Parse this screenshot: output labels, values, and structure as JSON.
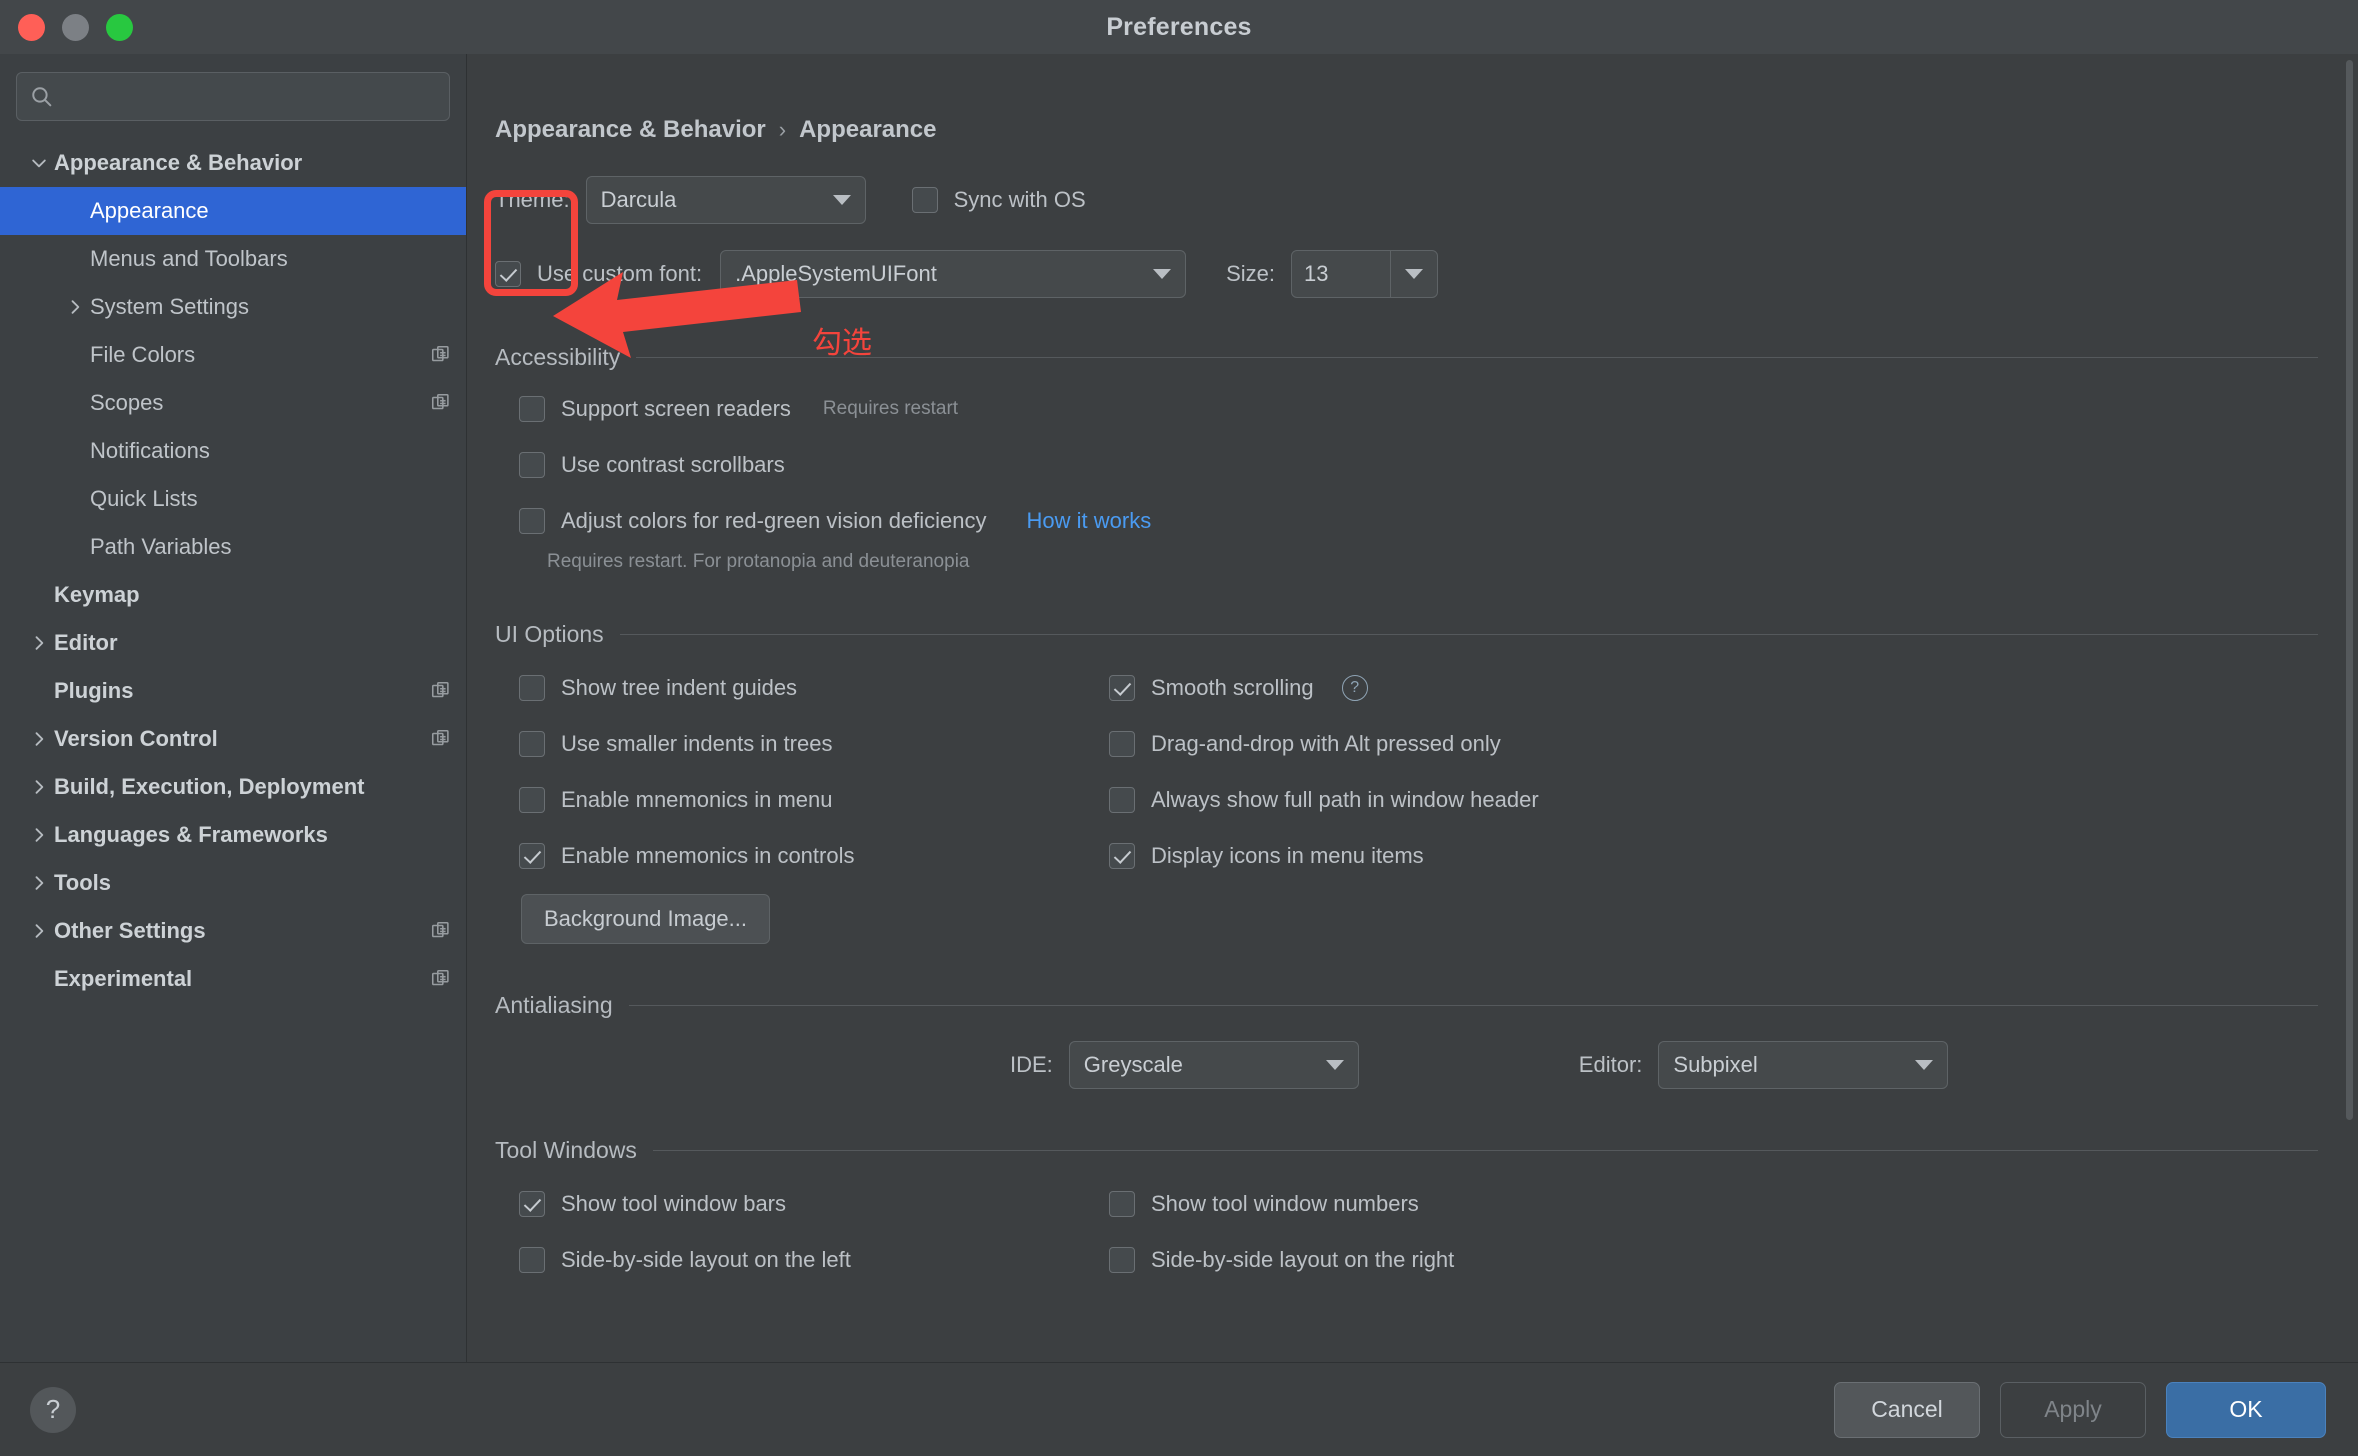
{
  "window": {
    "title": "Preferences",
    "traffic_lights": [
      "close",
      "minimize",
      "zoom"
    ]
  },
  "sidebar": {
    "search_placeholder": "",
    "search_value": "",
    "items": [
      {
        "label": "Appearance & Behavior",
        "indent": 0,
        "arrow": "down",
        "bold": true,
        "selected": false,
        "copy": false
      },
      {
        "label": "Appearance",
        "indent": 1,
        "arrow": "none",
        "bold": false,
        "selected": true,
        "copy": false
      },
      {
        "label": "Menus and Toolbars",
        "indent": 1,
        "arrow": "none",
        "bold": false,
        "selected": false,
        "copy": false
      },
      {
        "label": "System Settings",
        "indent": 1,
        "arrow": "right",
        "bold": false,
        "selected": false,
        "copy": false
      },
      {
        "label": "File Colors",
        "indent": 1,
        "arrow": "none",
        "bold": false,
        "selected": false,
        "copy": true
      },
      {
        "label": "Scopes",
        "indent": 1,
        "arrow": "none",
        "bold": false,
        "selected": false,
        "copy": true
      },
      {
        "label": "Notifications",
        "indent": 1,
        "arrow": "none",
        "bold": false,
        "selected": false,
        "copy": false
      },
      {
        "label": "Quick Lists",
        "indent": 1,
        "arrow": "none",
        "bold": false,
        "selected": false,
        "copy": false
      },
      {
        "label": "Path Variables",
        "indent": 1,
        "arrow": "none",
        "bold": false,
        "selected": false,
        "copy": false
      },
      {
        "label": "Keymap",
        "indent": 0,
        "arrow": "none",
        "bold": true,
        "selected": false,
        "copy": false
      },
      {
        "label": "Editor",
        "indent": 0,
        "arrow": "right",
        "bold": true,
        "selected": false,
        "copy": false
      },
      {
        "label": "Plugins",
        "indent": 0,
        "arrow": "none",
        "bold": true,
        "selected": false,
        "copy": true
      },
      {
        "label": "Version Control",
        "indent": 0,
        "arrow": "right",
        "bold": true,
        "selected": false,
        "copy": true
      },
      {
        "label": "Build, Execution, Deployment",
        "indent": 0,
        "arrow": "right",
        "bold": true,
        "selected": false,
        "copy": false
      },
      {
        "label": "Languages & Frameworks",
        "indent": 0,
        "arrow": "right",
        "bold": true,
        "selected": false,
        "copy": false
      },
      {
        "label": "Tools",
        "indent": 0,
        "arrow": "right",
        "bold": true,
        "selected": false,
        "copy": false
      },
      {
        "label": "Other Settings",
        "indent": 0,
        "arrow": "right",
        "bold": true,
        "selected": false,
        "copy": true
      },
      {
        "label": "Experimental",
        "indent": 0,
        "arrow": "none",
        "bold": true,
        "selected": false,
        "copy": true
      }
    ]
  },
  "breadcrumb": {
    "parent": "Appearance & Behavior",
    "separator": "›",
    "current": "Appearance"
  },
  "theme_row": {
    "label": "Theme:",
    "value": "Darcula",
    "sync_label": "Sync with OS",
    "sync_checked": false
  },
  "font_row": {
    "checkbox_label": "Use custom font:",
    "checkbox_checked": true,
    "font_value": ".AppleSystemUIFont",
    "size_label": "Size:",
    "size_value": "13"
  },
  "accessibility": {
    "title": "Accessibility",
    "options": [
      {
        "label": "Support screen readers",
        "checked": false,
        "hint": "Requires restart",
        "link": ""
      },
      {
        "label": "Use contrast scrollbars",
        "checked": false,
        "hint": "",
        "link": ""
      },
      {
        "label": "Adjust colors for red-green vision deficiency",
        "checked": false,
        "hint": "",
        "link": "How it works"
      }
    ],
    "footnote": "Requires restart. For protanopia and deuteranopia"
  },
  "ui_options": {
    "title": "UI Options",
    "left": [
      {
        "label": "Show tree indent guides",
        "checked": false
      },
      {
        "label": "Use smaller indents in trees",
        "checked": false
      },
      {
        "label": "Enable mnemonics in menu",
        "checked": false
      },
      {
        "label": "Enable mnemonics in controls",
        "checked": true
      }
    ],
    "right": [
      {
        "label": "Smooth scrolling",
        "checked": true,
        "help": true
      },
      {
        "label": "Drag-and-drop with Alt pressed only",
        "checked": false,
        "help": false
      },
      {
        "label": "Always show full path in window header",
        "checked": false,
        "help": false
      },
      {
        "label": "Display icons in menu items",
        "checked": true,
        "help": false
      }
    ],
    "background_image_button": "Background Image..."
  },
  "antialiasing": {
    "title": "Antialiasing",
    "ide_label": "IDE:",
    "ide_value": "Greyscale",
    "editor_label": "Editor:",
    "editor_value": "Subpixel"
  },
  "tool_windows": {
    "title": "Tool Windows",
    "left": [
      {
        "label": "Show tool window bars",
        "checked": true
      },
      {
        "label": "Side-by-side layout on the left",
        "checked": false
      }
    ],
    "right": [
      {
        "label": "Show tool window numbers",
        "checked": false
      },
      {
        "label": "Side-by-side layout on the right",
        "checked": false
      }
    ]
  },
  "footer": {
    "help": "?",
    "cancel": "Cancel",
    "apply": "Apply",
    "ok": "OK"
  },
  "annotations": {
    "color": "#f4443c",
    "note_text": "勾选"
  }
}
